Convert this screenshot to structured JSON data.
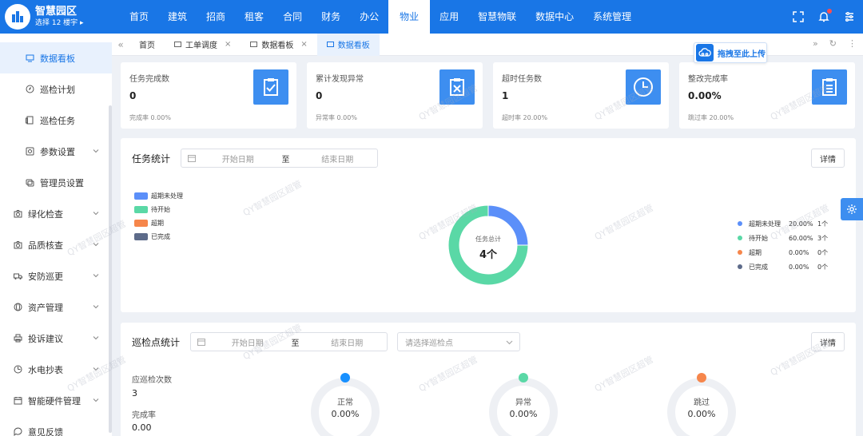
{
  "app": {
    "title": "智慧园区",
    "building_selector": "选择 12 楼宇 ▸"
  },
  "nav": [
    "首页",
    "建筑",
    "招商",
    "租客",
    "合同",
    "财务",
    "办公",
    "物业",
    "应用",
    "智慧物联",
    "数据中心",
    "系统管理"
  ],
  "nav_active_index": 7,
  "sidebar": {
    "items": [
      {
        "label": "数据看板",
        "icon": "dashboard-icon",
        "level": "sub",
        "active": true,
        "arrow": false
      },
      {
        "label": "巡检计划",
        "icon": "compass-icon",
        "level": "sub",
        "active": false,
        "arrow": false
      },
      {
        "label": "巡检任务",
        "icon": "task-icon",
        "level": "sub",
        "active": false,
        "arrow": false
      },
      {
        "label": "参数设置",
        "icon": "settings-icon",
        "level": "sub",
        "active": false,
        "arrow": true
      },
      {
        "label": "管理员设置",
        "icon": "admin-icon",
        "level": "sub",
        "active": false,
        "arrow": false
      },
      {
        "label": "绿化检查",
        "icon": "camera-icon",
        "level": "top",
        "active": false,
        "arrow": true
      },
      {
        "label": "品质核查",
        "icon": "camera-icon",
        "level": "top",
        "active": false,
        "arrow": true
      },
      {
        "label": "安防巡更",
        "icon": "truck-icon",
        "level": "top",
        "active": false,
        "arrow": true
      },
      {
        "label": "资产管理",
        "icon": "globe-icon",
        "level": "top",
        "active": false,
        "arrow": true
      },
      {
        "label": "投诉建议",
        "icon": "printer-icon",
        "level": "top",
        "active": false,
        "arrow": true
      },
      {
        "label": "水电抄表",
        "icon": "meter-icon",
        "level": "top",
        "active": false,
        "arrow": true
      },
      {
        "label": "智能硬件管理",
        "icon": "calendar-icon",
        "level": "top",
        "active": false,
        "arrow": true
      },
      {
        "label": "意见反馈",
        "icon": "chat-icon",
        "level": "top",
        "active": false,
        "arrow": false
      }
    ]
  },
  "tabs": [
    {
      "label": "首页",
      "closable": false,
      "active": false
    },
    {
      "label": "工单调度",
      "closable": true,
      "active": false
    },
    {
      "label": "数据看板",
      "closable": true,
      "active": false
    },
    {
      "label": "数据看板",
      "closable": false,
      "active": true
    }
  ],
  "upload_button": "拖拽至此上传",
  "stats": [
    {
      "label": "任务完成数",
      "value": "0",
      "rate": "完成率 0.00%",
      "icon": "clipboard-check-icon"
    },
    {
      "label": "累计发现异常",
      "value": "0",
      "rate": "异常率 0.00%",
      "icon": "clipboard-x-icon"
    },
    {
      "label": "超时任务数",
      "value": "1",
      "rate": "超时率 20.00%",
      "icon": "clock-icon"
    },
    {
      "label": "整改完成率",
      "value": "0.00%",
      "rate": "跳过率 20.00%",
      "icon": "clipboard-list-icon"
    }
  ],
  "task_panel": {
    "title": "任务统计",
    "date_start": "开始日期",
    "date_to": "至",
    "date_end": "结束日期",
    "detail": "详情",
    "center_label": "任务总计",
    "center_value": "4个"
  },
  "chart_data": {
    "type": "pie",
    "categories": [
      "超期未处理",
      "待开始",
      "超期",
      "已完成"
    ],
    "values": [
      1,
      3,
      0,
      0
    ],
    "percents": [
      "20.00%",
      "60.00%",
      "0.00%",
      "0.00%"
    ],
    "counts": [
      "1个",
      "3个",
      "0个",
      "0个"
    ],
    "colors": [
      "#5b8ff9",
      "#5ad8a6",
      "#f6864b",
      "#5d6b8a"
    ]
  },
  "inspection_panel": {
    "title": "巡检点统计",
    "date_start": "开始日期",
    "date_to": "至",
    "date_end": "结束日期",
    "select_placeholder": "请选择巡检点",
    "detail": "详情",
    "metrics": [
      {
        "label": "应巡检次数",
        "value": "3"
      },
      {
        "label": "完成率",
        "value": "0.00"
      }
    ],
    "gauges": [
      {
        "label": "正常",
        "value": "0.00%",
        "color": "#1890ff",
        "fraction": 0
      },
      {
        "label": "异常",
        "value": "0.00%",
        "color": "#5ad8a6",
        "fraction": 0
      },
      {
        "label": "跳过",
        "value": "0.00%",
        "color": "#f6864b",
        "fraction": 0
      }
    ]
  },
  "watermark_text": "QY智慧园区超管"
}
